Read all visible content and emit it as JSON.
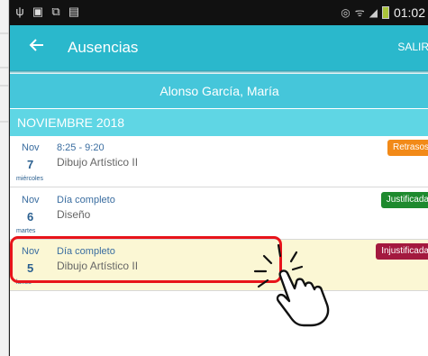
{
  "status_bar": {
    "left_icons": [
      "usb-icon",
      "image-icon",
      "cast-icon",
      "file-icon"
    ],
    "right_icons": [
      "eye-icon",
      "wifi-icon",
      "signal-icon",
      "battery-icon"
    ],
    "time": "01:02"
  },
  "app_bar": {
    "title": "Ausencias",
    "exit_label": "SALIR"
  },
  "student": {
    "name": "Alonso García, María"
  },
  "month_header": "NOVIEMBRE 2018",
  "absences": [
    {
      "month": "Nov",
      "day": "7",
      "weekday": "miércoles",
      "time": "8:25 - 9:20",
      "subject": "Dibujo Artístico II",
      "status": "Retrasos",
      "status_color": "#f28a18"
    },
    {
      "month": "Nov",
      "day": "6",
      "weekday": "martes",
      "time": "Día completo",
      "subject": "Diseño",
      "status": "Justificada",
      "status_color": "#1e8a2e"
    },
    {
      "month": "Nov",
      "day": "5",
      "weekday": "lunes",
      "time": "Día completo",
      "subject": "Dibujo Artístico II",
      "status": "Injustificada",
      "status_color": "#a3193f"
    }
  ],
  "colors": {
    "app_bar": "#2ab8cc",
    "student_bar": "#45c6da",
    "month_bar": "#5fd6e4",
    "highlight_row": "#fbf7d4",
    "annotation_red": "#e8141a"
  }
}
